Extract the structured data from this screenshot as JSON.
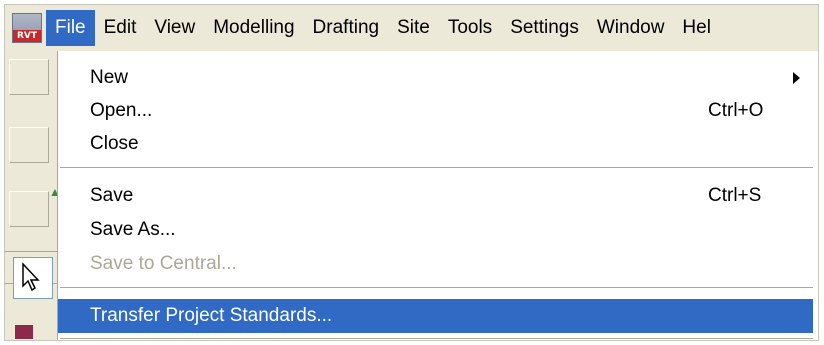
{
  "app": {
    "icon_text": "RVT"
  },
  "menubar": {
    "items": [
      {
        "label": "File"
      },
      {
        "label": "Edit"
      },
      {
        "label": "View"
      },
      {
        "label": "Modelling"
      },
      {
        "label": "Drafting"
      },
      {
        "label": "Site"
      },
      {
        "label": "Tools"
      },
      {
        "label": "Settings"
      },
      {
        "label": "Window"
      },
      {
        "label": "Hel"
      }
    ],
    "active": "File"
  },
  "file_menu": {
    "items": [
      {
        "label": "New",
        "shortcut": "",
        "submenu": true,
        "state": "normal"
      },
      {
        "label": "Open...",
        "shortcut": "Ctrl+O",
        "submenu": false,
        "state": "normal"
      },
      {
        "label": "Close",
        "shortcut": "",
        "submenu": false,
        "state": "normal"
      },
      {
        "label": "Save",
        "shortcut": "Ctrl+S",
        "submenu": false,
        "state": "normal"
      },
      {
        "label": "Save As...",
        "shortcut": "",
        "submenu": false,
        "state": "normal"
      },
      {
        "label": "Save to Central...",
        "shortcut": "",
        "submenu": false,
        "state": "disabled"
      },
      {
        "label": "Transfer Project Standards...",
        "shortcut": "",
        "submenu": false,
        "state": "highlighted"
      }
    ]
  },
  "colors": {
    "highlight": "#316ac5",
    "menu_background": "#ece9d8",
    "disabled_text": "#aca899"
  }
}
